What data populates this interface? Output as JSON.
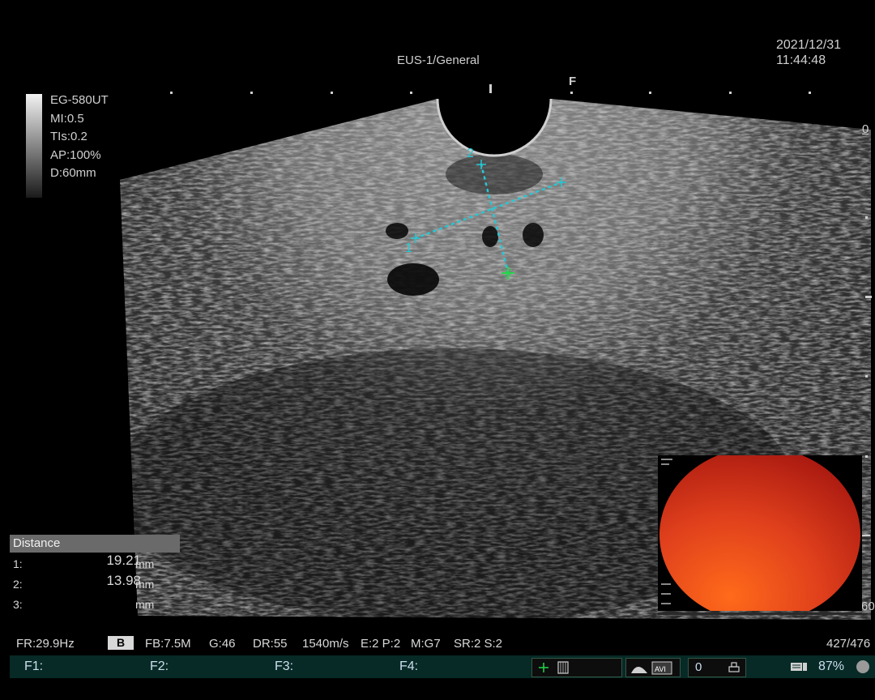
{
  "header": {
    "mode_title": "EUS-1/General",
    "date": "2021/12/31",
    "time": "11:44:48"
  },
  "probe_info": {
    "model": "EG-580UT",
    "mi": "MI:0.5",
    "tis": "TIs:0.2",
    "ap": "AP:100%",
    "depth": "D:60mm"
  },
  "depth_scale": {
    "top_label": "0",
    "bottom_label": "60",
    "orientation_marker": "F"
  },
  "distance_panel": {
    "title": "Distance",
    "rows": [
      {
        "index": "1:",
        "value": "19.21",
        "unit": "mm"
      },
      {
        "index": "2:",
        "value": "13.98",
        "unit": "mm"
      },
      {
        "index": "3:",
        "value": "",
        "unit": "mm"
      }
    ]
  },
  "measurement_labels": {
    "caliper_1": "1",
    "caliper_2": "2"
  },
  "params": {
    "frame_rate": "FR:29.9Hz",
    "mode": "B",
    "fb": "FB:7.5M",
    "gain": "G:46",
    "dr": "DR:55",
    "sound_speed": "1540m/s",
    "ep": "E:2 P:2",
    "mg": "M:G7",
    "srs": "SR:2 S:2",
    "frame_counter": "427/476"
  },
  "function_keys": {
    "f1": "F1:",
    "f2": "F2:",
    "f3": "F3:",
    "f4": "F4:",
    "counter_value": "0",
    "battery_percent": "87%"
  },
  "colors": {
    "caliper_cyan": "#25c8d4",
    "cursor_green": "#22d84a",
    "fkey_bar": "#072a26",
    "endoscope_red": "#e0401c"
  }
}
